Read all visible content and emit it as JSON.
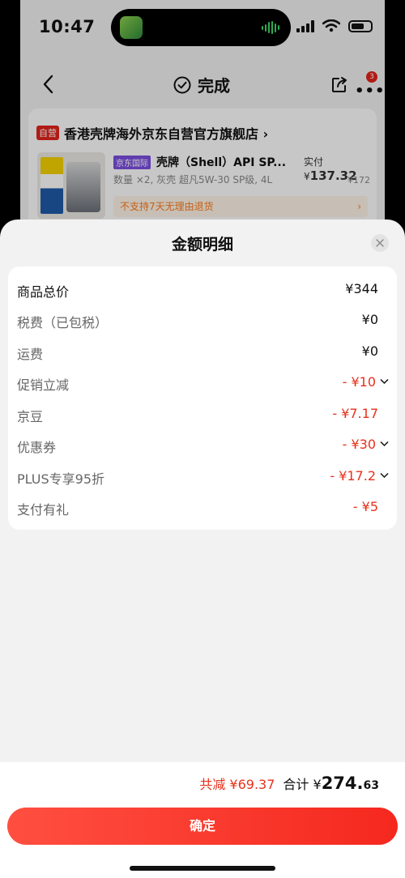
{
  "status_bar": {
    "time": "10:47"
  },
  "nav": {
    "title": "完成",
    "badge": "3"
  },
  "store": {
    "tag": "自营",
    "name": "香港壳牌海外京东自营官方旗舰店 ›"
  },
  "product": {
    "tag": "京东国际",
    "title": "壳牌（Shell）API SP...",
    "spec": "数量 ×2, 灰壳 超凡5W-30 SP级, 4L",
    "paid_label": "实付 ¥",
    "paid_value": "137.32",
    "original_price": "¥172",
    "return_notice": "不支持7天无理由退货",
    "return_arrow": "›"
  },
  "sheet": {
    "title": "金额明细",
    "rows": [
      {
        "label": "商品总价",
        "value": "¥344"
      },
      {
        "label": "税费（已包税）",
        "value": "¥0"
      },
      {
        "label": "运费",
        "value": "¥0"
      },
      {
        "label": "促销立减",
        "value": "- ¥10"
      },
      {
        "label": "京豆",
        "value": "- ¥7.17"
      },
      {
        "label": "优惠券",
        "value": "- ¥30"
      },
      {
        "label": "PLUS专享95折",
        "value": "- ¥17.2"
      },
      {
        "label": "支付有礼",
        "value": "- ¥5"
      }
    ]
  },
  "footer": {
    "saved": "共减 ¥69.37",
    "total_label": "合计 ¥",
    "total_int": "274.",
    "total_dec": "63",
    "confirm": "确定"
  },
  "colors": {
    "accent_red": "#e8301c",
    "notice_orange": "#ff7a1a",
    "tag_purple": "#7b4fe0"
  },
  "icons": [
    "back-arrow",
    "check-circle",
    "share",
    "more-dots",
    "close",
    "chevron-down"
  ]
}
